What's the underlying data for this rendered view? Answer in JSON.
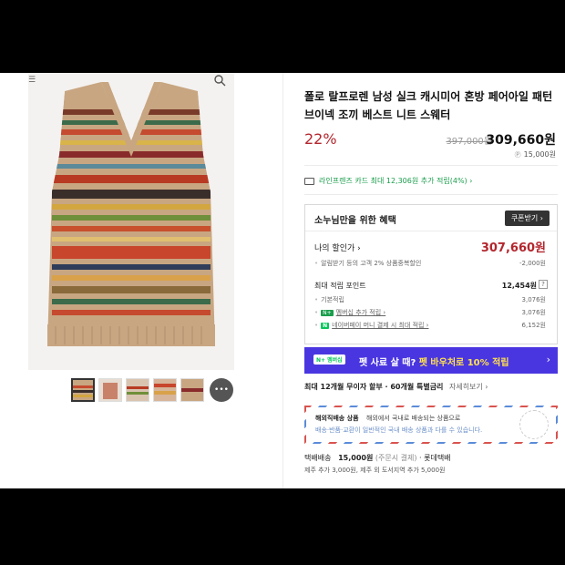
{
  "gallery": {
    "menu_glyph": "☰",
    "more_label": "•••"
  },
  "product": {
    "title": "폴로 랄프로렌 남성 실크 캐시미어 혼방 페어아일 패턴 브이넥 조끼 베스트 니트 스웨터",
    "discount": "22%",
    "original_price": "397,000원",
    "sale_price": "309,660원",
    "points": "15,000원"
  },
  "card_promo": {
    "text": "라인프렌즈 카드 최대 12,306원 추가 적립(4%) ›"
  },
  "benefit": {
    "title": "소누님만을 위한 혜택",
    "coupon_button": "쿠폰받기 ›",
    "my_price_label": "나의 할인가 ›",
    "my_price_value": "307,660원",
    "coupon_desc": "알림받기 등의 고객 2% 상품중복할인",
    "coupon_value": "-2,000원",
    "max_points_label": "최대 적립 포인트",
    "max_points_value": "12,454원",
    "help": "?",
    "rows": [
      {
        "label": "기본적립",
        "value": "3,076원"
      },
      {
        "tag": "N+",
        "label": "멤버십 추가 적립 ›",
        "value": "3,076원"
      },
      {
        "tag": "N",
        "label": "네이버페이 머니 결제 시 최대 적립 ›",
        "value": "6,152원"
      }
    ]
  },
  "napay": {
    "tag": "N+ 멤버십",
    "text_1": "펫 사료 살 때? ",
    "text_2": "펫 바우처로 10% 적립",
    "arrow": "›"
  },
  "install": {
    "bold": "최대 12개월 무이자 할부 · 60개월 특별금리",
    "link": "자세히보기 ›"
  },
  "overseas": {
    "title": "해외직배송 상품",
    "desc_1": "해외에서 국내로 배송되는 상품으로",
    "desc_2": "배송·반품·교환이 일반적인 국내 배송 상품과 다를 수 있습니다."
  },
  "shipping": {
    "label": "택배배송",
    "fee": "15,000원",
    "note": "(주문시 결제)",
    "carrier": "· 롯데택배",
    "extra": "제주 추가 3,000원, 제주 외 도서지역 추가 5,000원"
  },
  "colors": {
    "accent_red": "#b3262d",
    "promo_green": "#1a9e4c",
    "banner_purple": "#4a36e0"
  }
}
